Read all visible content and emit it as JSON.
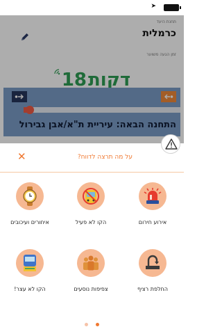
{
  "status_bar": {
    "location_icon": "location-arrow-icon",
    "battery_icon": "battery-icon"
  },
  "destination": {
    "label": "תחנת היעד",
    "value": "כרמלית",
    "edit_icon": "pencil-icon"
  },
  "eta": {
    "label": "זמן הגעה משוער",
    "value": "18",
    "unit": "דקות",
    "realtime_icon": "signal-waves-icon"
  },
  "route": {
    "start_icon": "arrow-right-dot-icon",
    "end_icon": "arrow-left-dot-icon",
    "progress": 0.04,
    "next_stop": "התחנה הבאה: עיריית ת\"א/אבן גבירול"
  },
  "report": {
    "title": "על מה תרצה לדווח?",
    "close_icon": "close-icon",
    "alert_icon": "warning-icon",
    "options": [
      {
        "label": "אירוע חירום",
        "icon": "emergency-siren-icon"
      },
      {
        "label": "הקו לא פעיל",
        "icon": "bus-not-active-icon"
      },
      {
        "label": "איחורים ועיכובים",
        "icon": "watch-icon"
      },
      {
        "label": "החלפת רציף",
        "icon": "platform-change-icon"
      },
      {
        "label": "צפיפות נוסעים",
        "icon": "crowd-icon"
      },
      {
        "label": "הקו לא עצר!",
        "icon": "bus-didnt-stop-icon"
      }
    ]
  },
  "pagination": {
    "active_color": "#f07830",
    "inactive_color": "#f6c3a8"
  },
  "colors": {
    "accent": "#f07830",
    "eta_green": "#2e9e54",
    "route_card": "#7b9cc7",
    "progress_red": "#f05a44"
  }
}
